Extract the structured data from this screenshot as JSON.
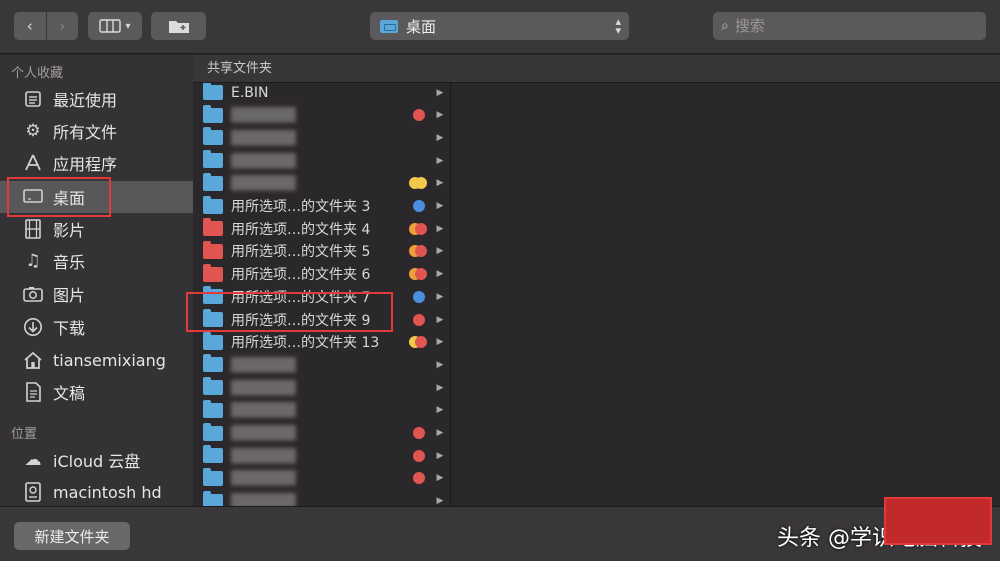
{
  "toolbar": {
    "back_icon": "chevron-left-icon",
    "forward_icon": "chevron-right-icon",
    "view_icon": "column-view-icon",
    "action_icon": "new-folder-icon",
    "location": "桌面",
    "search_placeholder": "搜索"
  },
  "sidebar": {
    "favorites_header": "个人收藏",
    "locations_header": "位置",
    "favorites": [
      {
        "label": "最近使用",
        "icon": "recents-icon"
      },
      {
        "label": "所有文件",
        "icon": "gear-icon"
      },
      {
        "label": "应用程序",
        "icon": "applications-icon"
      },
      {
        "label": "桌面",
        "icon": "desktop-icon",
        "selected": true
      },
      {
        "label": "影片",
        "icon": "film-icon"
      },
      {
        "label": "音乐",
        "icon": "music-note-icon"
      },
      {
        "label": "图片",
        "icon": "camera-icon"
      },
      {
        "label": "下载",
        "icon": "download-icon"
      },
      {
        "label": "tiansemixiang",
        "icon": "home-icon"
      },
      {
        "label": "文稿",
        "icon": "document-icon"
      }
    ],
    "locations": [
      {
        "label": "iCloud 云盘",
        "icon": "cloud-icon"
      },
      {
        "label": "macintosh hd",
        "icon": "disk-icon"
      }
    ]
  },
  "columns": {
    "header": "共享文件夹",
    "rows": [
      {
        "name": "E.BIN",
        "color": "blue",
        "tags": [],
        "blurred": false
      },
      {
        "name": "",
        "color": "blue",
        "tags": [
          "#e0554f"
        ],
        "blurred": true
      },
      {
        "name": "",
        "color": "blue",
        "tags": [],
        "blurred": true
      },
      {
        "name": "",
        "color": "blue",
        "tags": [],
        "blurred": true
      },
      {
        "name": "",
        "color": "blue",
        "tags": [
          "#f2c94c",
          "#f2c94c"
        ],
        "blurred": true
      },
      {
        "name": "用所选项…的文件夹 3",
        "color": "blue",
        "tags": [
          "#4a8fe0"
        ],
        "blurred": false
      },
      {
        "name": "用所选项…的文件夹 4",
        "color": "red",
        "tags": [
          "#f0a03a",
          "#e0554f"
        ],
        "blurred": false
      },
      {
        "name": "用所选项…的文件夹 5",
        "color": "red",
        "tags": [
          "#f0a03a",
          "#e0554f"
        ],
        "blurred": false
      },
      {
        "name": "用所选项…的文件夹 6",
        "color": "red",
        "tags": [
          "#f0a03a",
          "#e0554f"
        ],
        "blurred": false
      },
      {
        "name": "用所选项…的文件夹 7",
        "color": "blue",
        "tags": [
          "#4a8fe0"
        ],
        "blurred": false
      },
      {
        "name": "用所选项…的文件夹 9",
        "color": "blue",
        "tags": [
          "#e0554f"
        ],
        "blurred": false
      },
      {
        "name": "用所选项…的文件夹 13",
        "color": "blue",
        "tags": [
          "#f2c94c",
          "#e0554f"
        ],
        "blurred": false
      },
      {
        "name": "",
        "color": "blue",
        "tags": [],
        "blurred": true
      },
      {
        "name": "",
        "color": "blue",
        "tags": [],
        "blurred": true
      },
      {
        "name": "",
        "color": "blue",
        "tags": [],
        "blurred": true
      },
      {
        "name": "",
        "color": "blue",
        "tags": [
          "#e0554f"
        ],
        "blurred": true
      },
      {
        "name": "",
        "color": "blue",
        "tags": [
          "#e0554f"
        ],
        "blurred": true
      },
      {
        "name": "",
        "color": "blue",
        "tags": [
          "#e0554f"
        ],
        "blurred": true
      },
      {
        "name": "",
        "color": "blue",
        "tags": [],
        "blurred": true
      }
    ]
  },
  "bottom": {
    "new_folder_label": "新建文件夹",
    "watermark": "头条 @学识电脑科技"
  },
  "colors": {
    "highlight_red": "#e23a3a",
    "folder_blue": "#5aa7d9",
    "folder_red": "#e0554f"
  }
}
